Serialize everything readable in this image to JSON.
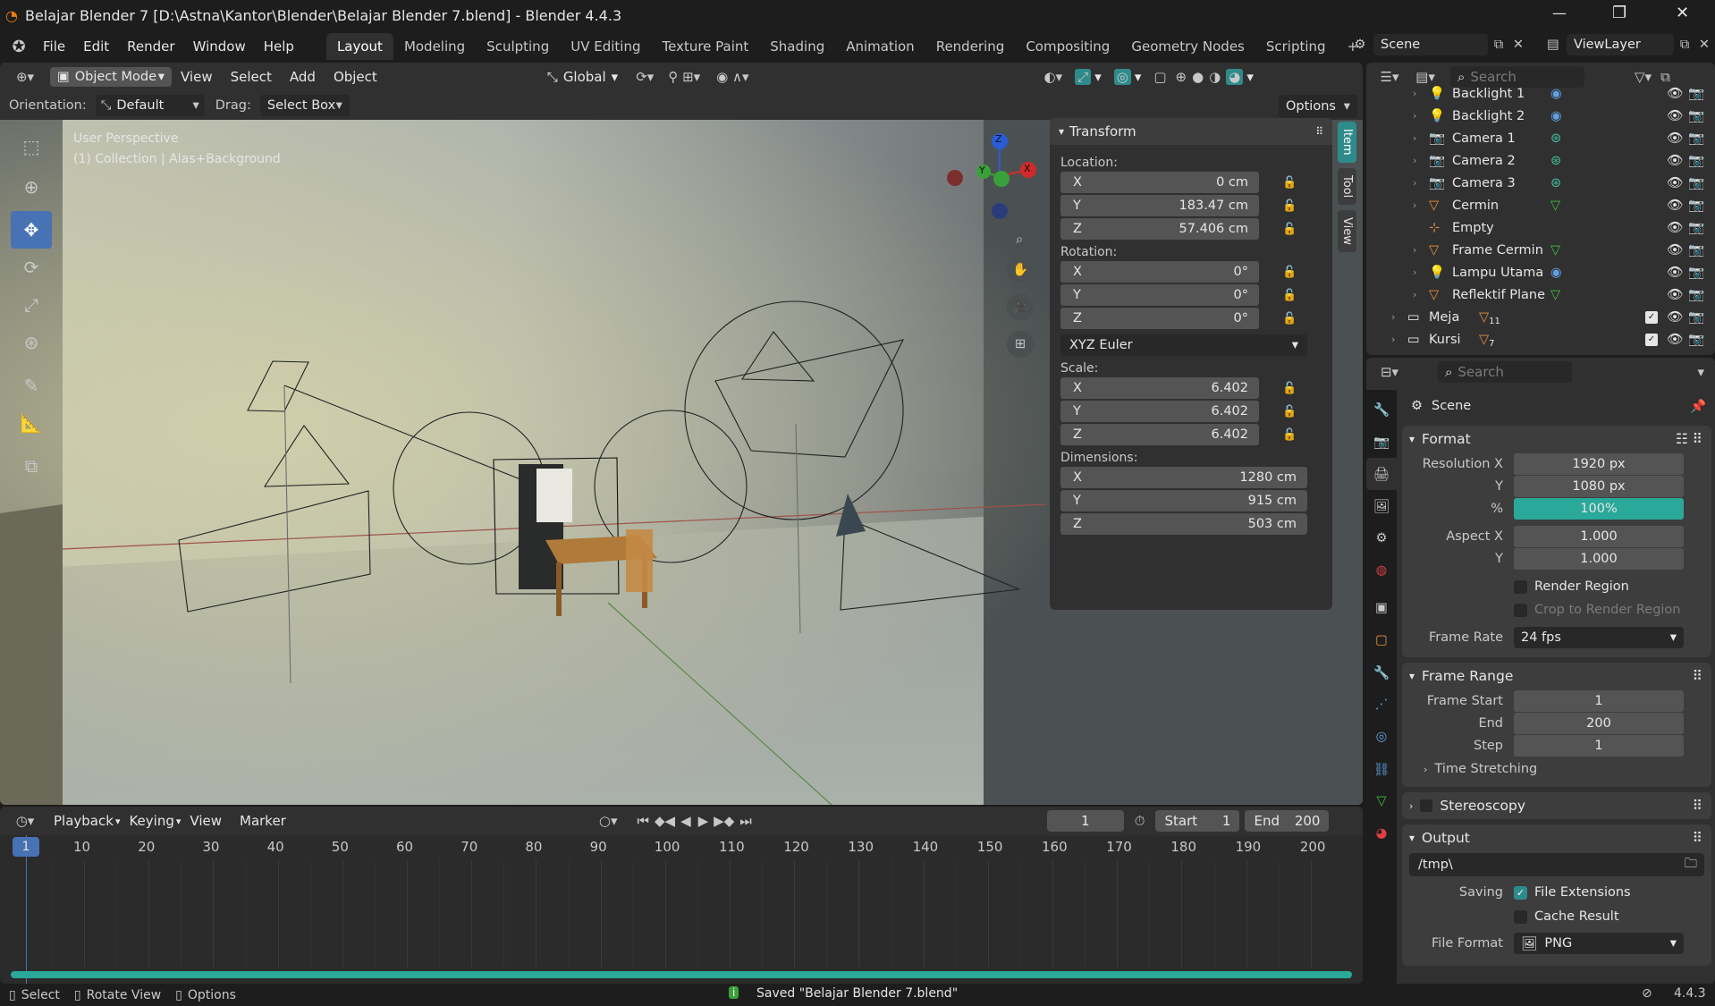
{
  "window": {
    "title": "Belajar Blender 7 [D:\\Astna\\Kantor\\Blender\\Belajar Blender 7.blend] - Blender 4.4.3",
    "min": "—",
    "max": "❐",
    "close": "✕"
  },
  "menu": [
    "File",
    "Edit",
    "Render",
    "Window",
    "Help"
  ],
  "workspaces": [
    "Layout",
    "Modeling",
    "Sculpting",
    "UV Editing",
    "Texture Paint",
    "Shading",
    "Animation",
    "Rendering",
    "Compositing",
    "Geometry Nodes",
    "Scripting",
    "+"
  ],
  "scene": {
    "name": "Scene",
    "viewlayer": "ViewLayer"
  },
  "viewport_header": {
    "mode": "Object Mode",
    "menus": [
      "View",
      "Select",
      "Add",
      "Object"
    ],
    "transform_space": "Global",
    "orientation_label": "Orientation:",
    "orientation": "Default",
    "drag_label": "Drag:",
    "drag": "Select Box",
    "options": "Options"
  },
  "viewport": {
    "perspective": "User Perspective",
    "collection": "(1) Collection | Alas+Background",
    "gizmo": {
      "x": "X",
      "y": "Y",
      "z": "Z"
    }
  },
  "sidebar_tabs": [
    "Item",
    "Tool",
    "View"
  ],
  "transform": {
    "title": "Transform",
    "location_label": "Location:",
    "location": [
      {
        "axis": "X",
        "value": "0 cm"
      },
      {
        "axis": "Y",
        "value": "183.47 cm"
      },
      {
        "axis": "Z",
        "value": "57.406 cm"
      }
    ],
    "rotation_label": "Rotation:",
    "rotation": [
      {
        "axis": "X",
        "value": "0°"
      },
      {
        "axis": "Y",
        "value": "0°"
      },
      {
        "axis": "Z",
        "value": "0°"
      }
    ],
    "rotation_mode": "XYZ Euler",
    "scale_label": "Scale:",
    "scale": [
      {
        "axis": "X",
        "value": "6.402"
      },
      {
        "axis": "Y",
        "value": "6.402"
      },
      {
        "axis": "Z",
        "value": "6.402"
      }
    ],
    "dimensions_label": "Dimensions:",
    "dimensions": [
      {
        "axis": "X",
        "value": "1280 cm"
      },
      {
        "axis": "Y",
        "value": "915 cm"
      },
      {
        "axis": "Z",
        "value": "503 cm"
      }
    ]
  },
  "outliner": {
    "search_placeholder": "Search",
    "items": [
      {
        "name": "Backlight 1",
        "type": "light"
      },
      {
        "name": "Backlight 2",
        "type": "light"
      },
      {
        "name": "Camera 1",
        "type": "camera"
      },
      {
        "name": "Camera 2",
        "type": "camera"
      },
      {
        "name": "Camera 3",
        "type": "camera"
      },
      {
        "name": "Cermin",
        "type": "mesh"
      },
      {
        "name": "Empty",
        "type": "empty"
      },
      {
        "name": "Frame Cermin",
        "type": "mesh"
      },
      {
        "name": "Lampu Utama",
        "type": "light"
      },
      {
        "name": "Reflektif Plane",
        "type": "mesh"
      }
    ],
    "collections": [
      {
        "name": "Meja",
        "count": "11"
      },
      {
        "name": "Kursi",
        "count": "7"
      }
    ]
  },
  "properties": {
    "search_placeholder": "Search",
    "context": "Scene",
    "format": {
      "title": "Format",
      "resolution_x_label": "Resolution X",
      "resolution_x": "1920 px",
      "y_label": "Y",
      "resolution_y": "1080 px",
      "pct_label": "%",
      "pct": "100%",
      "aspect_x_label": "Aspect X",
      "aspect_x": "1.000",
      "aspect_y_label": "Y",
      "aspect_y": "1.000",
      "render_region": "Render Region",
      "crop": "Crop to Render Region",
      "frame_rate_label": "Frame Rate",
      "frame_rate": "24 fps"
    },
    "frame_range": {
      "title": "Frame Range",
      "start_label": "Frame Start",
      "start": "1",
      "end_label": "End",
      "end": "200",
      "step_label": "Step",
      "step": "1",
      "time_stretching": "Time Stretching"
    },
    "stereoscopy": "Stereoscopy",
    "output": {
      "title": "Output",
      "path": "/tmp\\",
      "saving_label": "Saving",
      "file_extensions": "File Extensions",
      "cache_result": "Cache Result",
      "file_format_label": "File Format",
      "file_format": "PNG"
    }
  },
  "timeline": {
    "menus": [
      "Playback",
      "Keying",
      "View",
      "Marker"
    ],
    "current_frame": "1",
    "start_label": "Start",
    "start": "1",
    "end_label": "End",
    "end": "200",
    "ticks": [
      "10",
      "20",
      "30",
      "40",
      "50",
      "60",
      "70",
      "80",
      "90",
      "100",
      "110",
      "120",
      "130",
      "140",
      "150",
      "160",
      "170",
      "180",
      "190",
      "200"
    ],
    "playhead": "1"
  },
  "statusbar": {
    "select": "Select",
    "rotate": "Rotate View",
    "options": "Options",
    "message": "Saved \"Belajar Blender 7.blend\"",
    "version": "4.4.3"
  }
}
